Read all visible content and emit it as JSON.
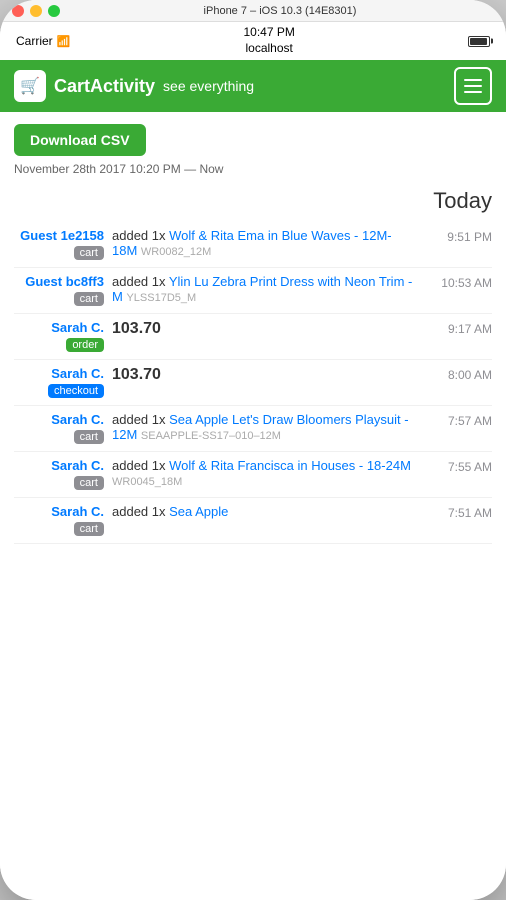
{
  "window": {
    "title": "iPhone 7 – iOS 10.3 (14E8301)"
  },
  "status_bar": {
    "carrier": "Carrier",
    "time": "10:47 PM",
    "host": "localhost"
  },
  "nav": {
    "logo": "🛒",
    "app_name": "CartActivity",
    "tagline": "see everything",
    "menu_label": "Menu"
  },
  "toolbar": {
    "download_label": "Download CSV",
    "date_range": "November 28th 2017 10:20 PM — Now"
  },
  "sections": [
    {
      "heading": "Today",
      "rows": [
        {
          "user": "Guest 1e2158",
          "badge": "cart",
          "badge_type": "cart",
          "action": "added 1x",
          "product_name": "Wolf & Rita Ema in Blue Waves - 12M-18M",
          "sku": "WR0082_12M",
          "time": "9:51 PM",
          "amount": ""
        },
        {
          "user": "Guest bc8ff3",
          "badge": "cart",
          "badge_type": "cart",
          "action": "added 1x",
          "product_name": "Ylin Lu Zebra Print Dress with Neon Trim - M",
          "sku": "YLSS17D5_M",
          "time": "10:53 AM",
          "amount": ""
        },
        {
          "user": "Sarah C.",
          "badge": "order",
          "badge_type": "order",
          "action": "",
          "product_name": "",
          "sku": "",
          "time": "9:17 AM",
          "amount": "103.70"
        },
        {
          "user": "Sarah C.",
          "badge": "checkout",
          "badge_type": "checkout",
          "action": "",
          "product_name": "",
          "sku": "",
          "time": "8:00 AM",
          "amount": "103.70"
        },
        {
          "user": "Sarah C.",
          "badge": "cart",
          "badge_type": "cart",
          "action": "added 1x",
          "product_name": "Sea Apple Let's Draw Bloomers Playsuit - 12M",
          "sku": "SEAAPPLE-SS17-010-12M",
          "time": "7:57 AM",
          "amount": ""
        },
        {
          "user": "Sarah C.",
          "badge": "cart",
          "badge_type": "cart",
          "action": "added 1x",
          "product_name": "Wolf & Rita Francisca in Houses - 18-24M",
          "sku": "WR0045_18M",
          "time": "7:55 AM",
          "amount": ""
        },
        {
          "user": "Sarah C.",
          "badge": "cart",
          "badge_type": "cart",
          "action": "added 1x",
          "product_name": "Sea Apple",
          "sku": "",
          "time": "7:51 AM",
          "amount": ""
        }
      ]
    }
  ]
}
